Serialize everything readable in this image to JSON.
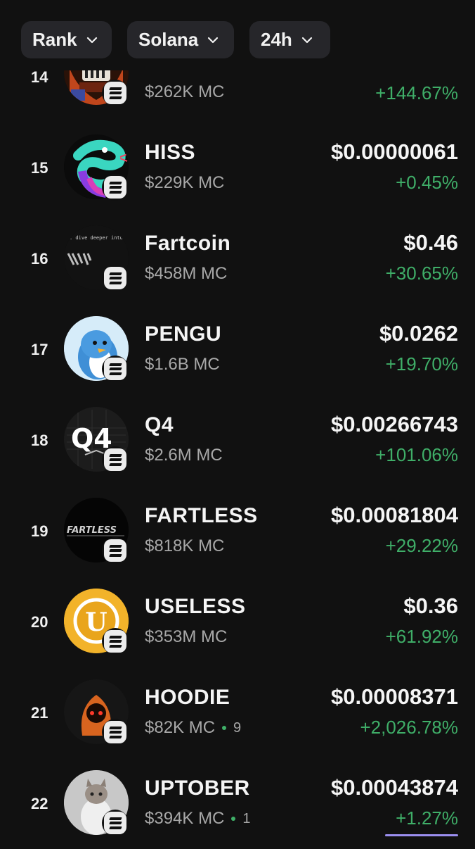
{
  "filters": [
    {
      "label": "Rank"
    },
    {
      "label": "Solana"
    },
    {
      "label": "24h"
    }
  ],
  "tokens": [
    {
      "rank": "14",
      "name": "",
      "mc": "$262K MC",
      "price": "",
      "change": "+144.67%",
      "holders": "",
      "avatar": "skull-mascot"
    },
    {
      "rank": "15",
      "name": "HISS",
      "mc": "$229K MC",
      "price": "$0.00000061",
      "change": "+0.45%",
      "holders": "",
      "avatar": "snake"
    },
    {
      "rank": "16",
      "name": "Fartcoin",
      "mc": "$458M MC",
      "price": "$0.46",
      "change": "+30.65%",
      "holders": "",
      "avatar": "fartcoin",
      "avatar_caption": ". dive deeper into this"
    },
    {
      "rank": "17",
      "name": "PENGU",
      "mc": "$1.6B MC",
      "price": "$0.0262",
      "change": "+19.70%",
      "holders": "",
      "avatar": "penguin"
    },
    {
      "rank": "18",
      "name": "Q4",
      "mc": "$2.6M MC",
      "price": "$0.00266743",
      "change": "+101.06%",
      "holders": "",
      "avatar": "q4",
      "avatar_text": "Q4"
    },
    {
      "rank": "19",
      "name": "FARTLESS",
      "mc": "$818K MC",
      "price": "$0.00081804",
      "change": "+29.22%",
      "holders": "",
      "avatar": "fartless",
      "avatar_text": "FARTLESS"
    },
    {
      "rank": "20",
      "name": "USELESS",
      "mc": "$353M MC",
      "price": "$0.36",
      "change": "+61.92%",
      "holders": "",
      "avatar": "useless-coin",
      "avatar_text": "U"
    },
    {
      "rank": "21",
      "name": "HOODIE",
      "mc": "$82K MC",
      "price": "$0.00008371",
      "change": "+2,026.78%",
      "holders": "9",
      "avatar": "hooded-figure"
    },
    {
      "rank": "22",
      "name": "UPTOBER",
      "mc": "$394K MC",
      "price": "$0.00043874",
      "change": "+1.27%",
      "holders": "1",
      "avatar": "cat"
    }
  ],
  "chain_badge_icon": "solana-icon",
  "colors": {
    "background": "#111111",
    "pill": "#26262a",
    "positive": "#3fae68",
    "muted": "#a8a8a8",
    "accent": "#9b8ff0"
  }
}
